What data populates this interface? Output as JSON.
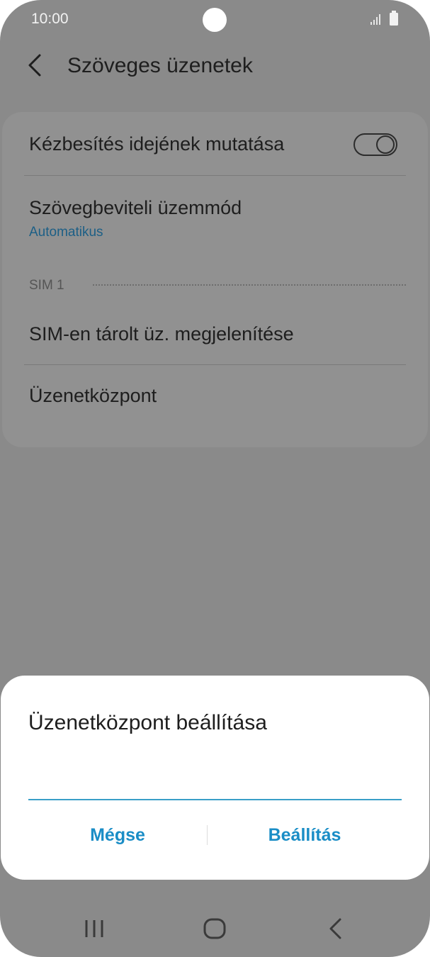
{
  "status_bar": {
    "time": "10:00"
  },
  "app_bar": {
    "title": "Szöveges üzenetek"
  },
  "settings": {
    "delivery_time": {
      "label": "Kézbesítés idejének mutatása",
      "enabled": false
    },
    "input_mode": {
      "label": "Szövegbeviteli üzemmód",
      "value": "Automatikus"
    },
    "section_sim1": "SIM 1",
    "sim_messages": {
      "label": "SIM-en tárolt üz. megjelenítése"
    },
    "message_center": {
      "label": "Üzenetközpont"
    }
  },
  "dialog": {
    "title": "Üzenetközpont beállítása",
    "input_value": "",
    "cancel_label": "Mégse",
    "confirm_label": "Beállítás"
  },
  "colors": {
    "accent": "#1a8dc6",
    "overlay": "#8a8a8a"
  },
  "icons": {
    "back": "back-arrow-icon",
    "recents": "recents-icon",
    "home": "home-icon",
    "nav_back": "nav-back-icon"
  }
}
